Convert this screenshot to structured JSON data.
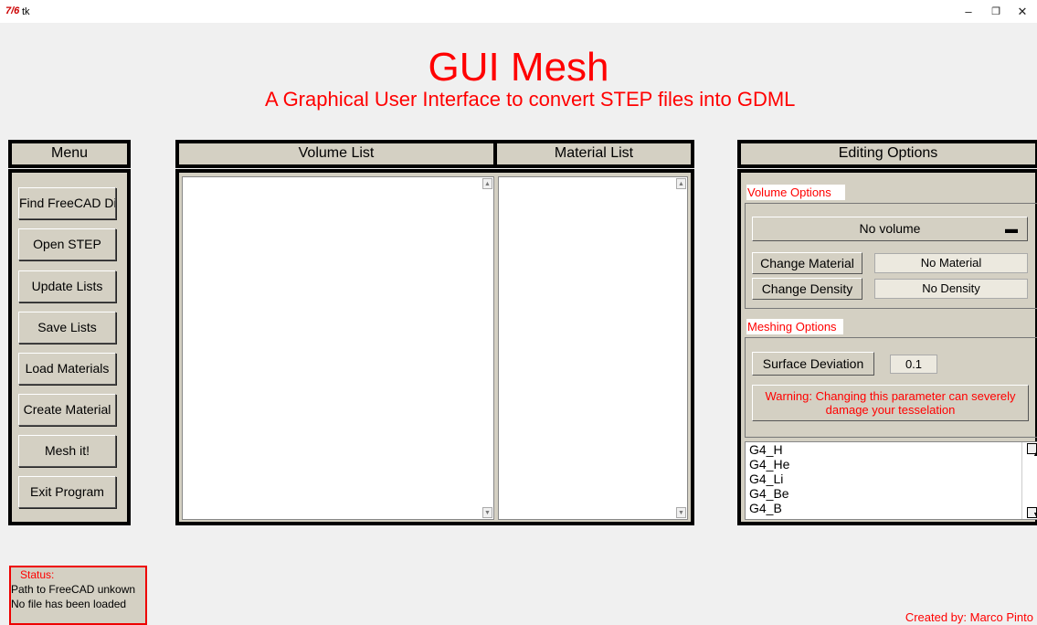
{
  "window": {
    "title": "tk",
    "logo_text": "7/6",
    "min_symbol": "–",
    "restore_symbol": "❐",
    "close_symbol": "✕"
  },
  "header": {
    "title": "GUI Mesh",
    "subtitle": "A Graphical User Interface to convert STEP files into GDML"
  },
  "menu": {
    "header": "Menu",
    "buttons": [
      "Find FreeCAD Di",
      "Open STEP",
      "Update Lists",
      "Save Lists",
      "Load Materials",
      "Create Material",
      "Mesh it!",
      "Exit Program"
    ]
  },
  "volume_list": {
    "header": "Volume List",
    "items": []
  },
  "material_list": {
    "header": "Material List",
    "items": []
  },
  "editing": {
    "header": "Editing Options",
    "volume_options_label": "Volume Options",
    "volume_select": "No volume",
    "change_material_label": "Change Material",
    "material_value": "No Material",
    "change_density_label": "Change Density",
    "density_value": "No Density",
    "meshing_options_label": "Meshing Options",
    "surface_deviation_label": "Surface Deviation",
    "surface_deviation_value": "0.1",
    "warning": "Warning: Changing this parameter can severely damage your tesselation",
    "materials": [
      "G4_H",
      "G4_He",
      "G4_Li",
      "G4_Be",
      "G4_B"
    ]
  },
  "status": {
    "label": "Status:",
    "line1": "Path to FreeCAD unkown",
    "line2": "No file has been loaded"
  },
  "credit": "Created by: Marco Pinto",
  "colors": {
    "accent": "#ff0000",
    "panel": "#d4d0c3",
    "background": "#f0f0f0"
  }
}
